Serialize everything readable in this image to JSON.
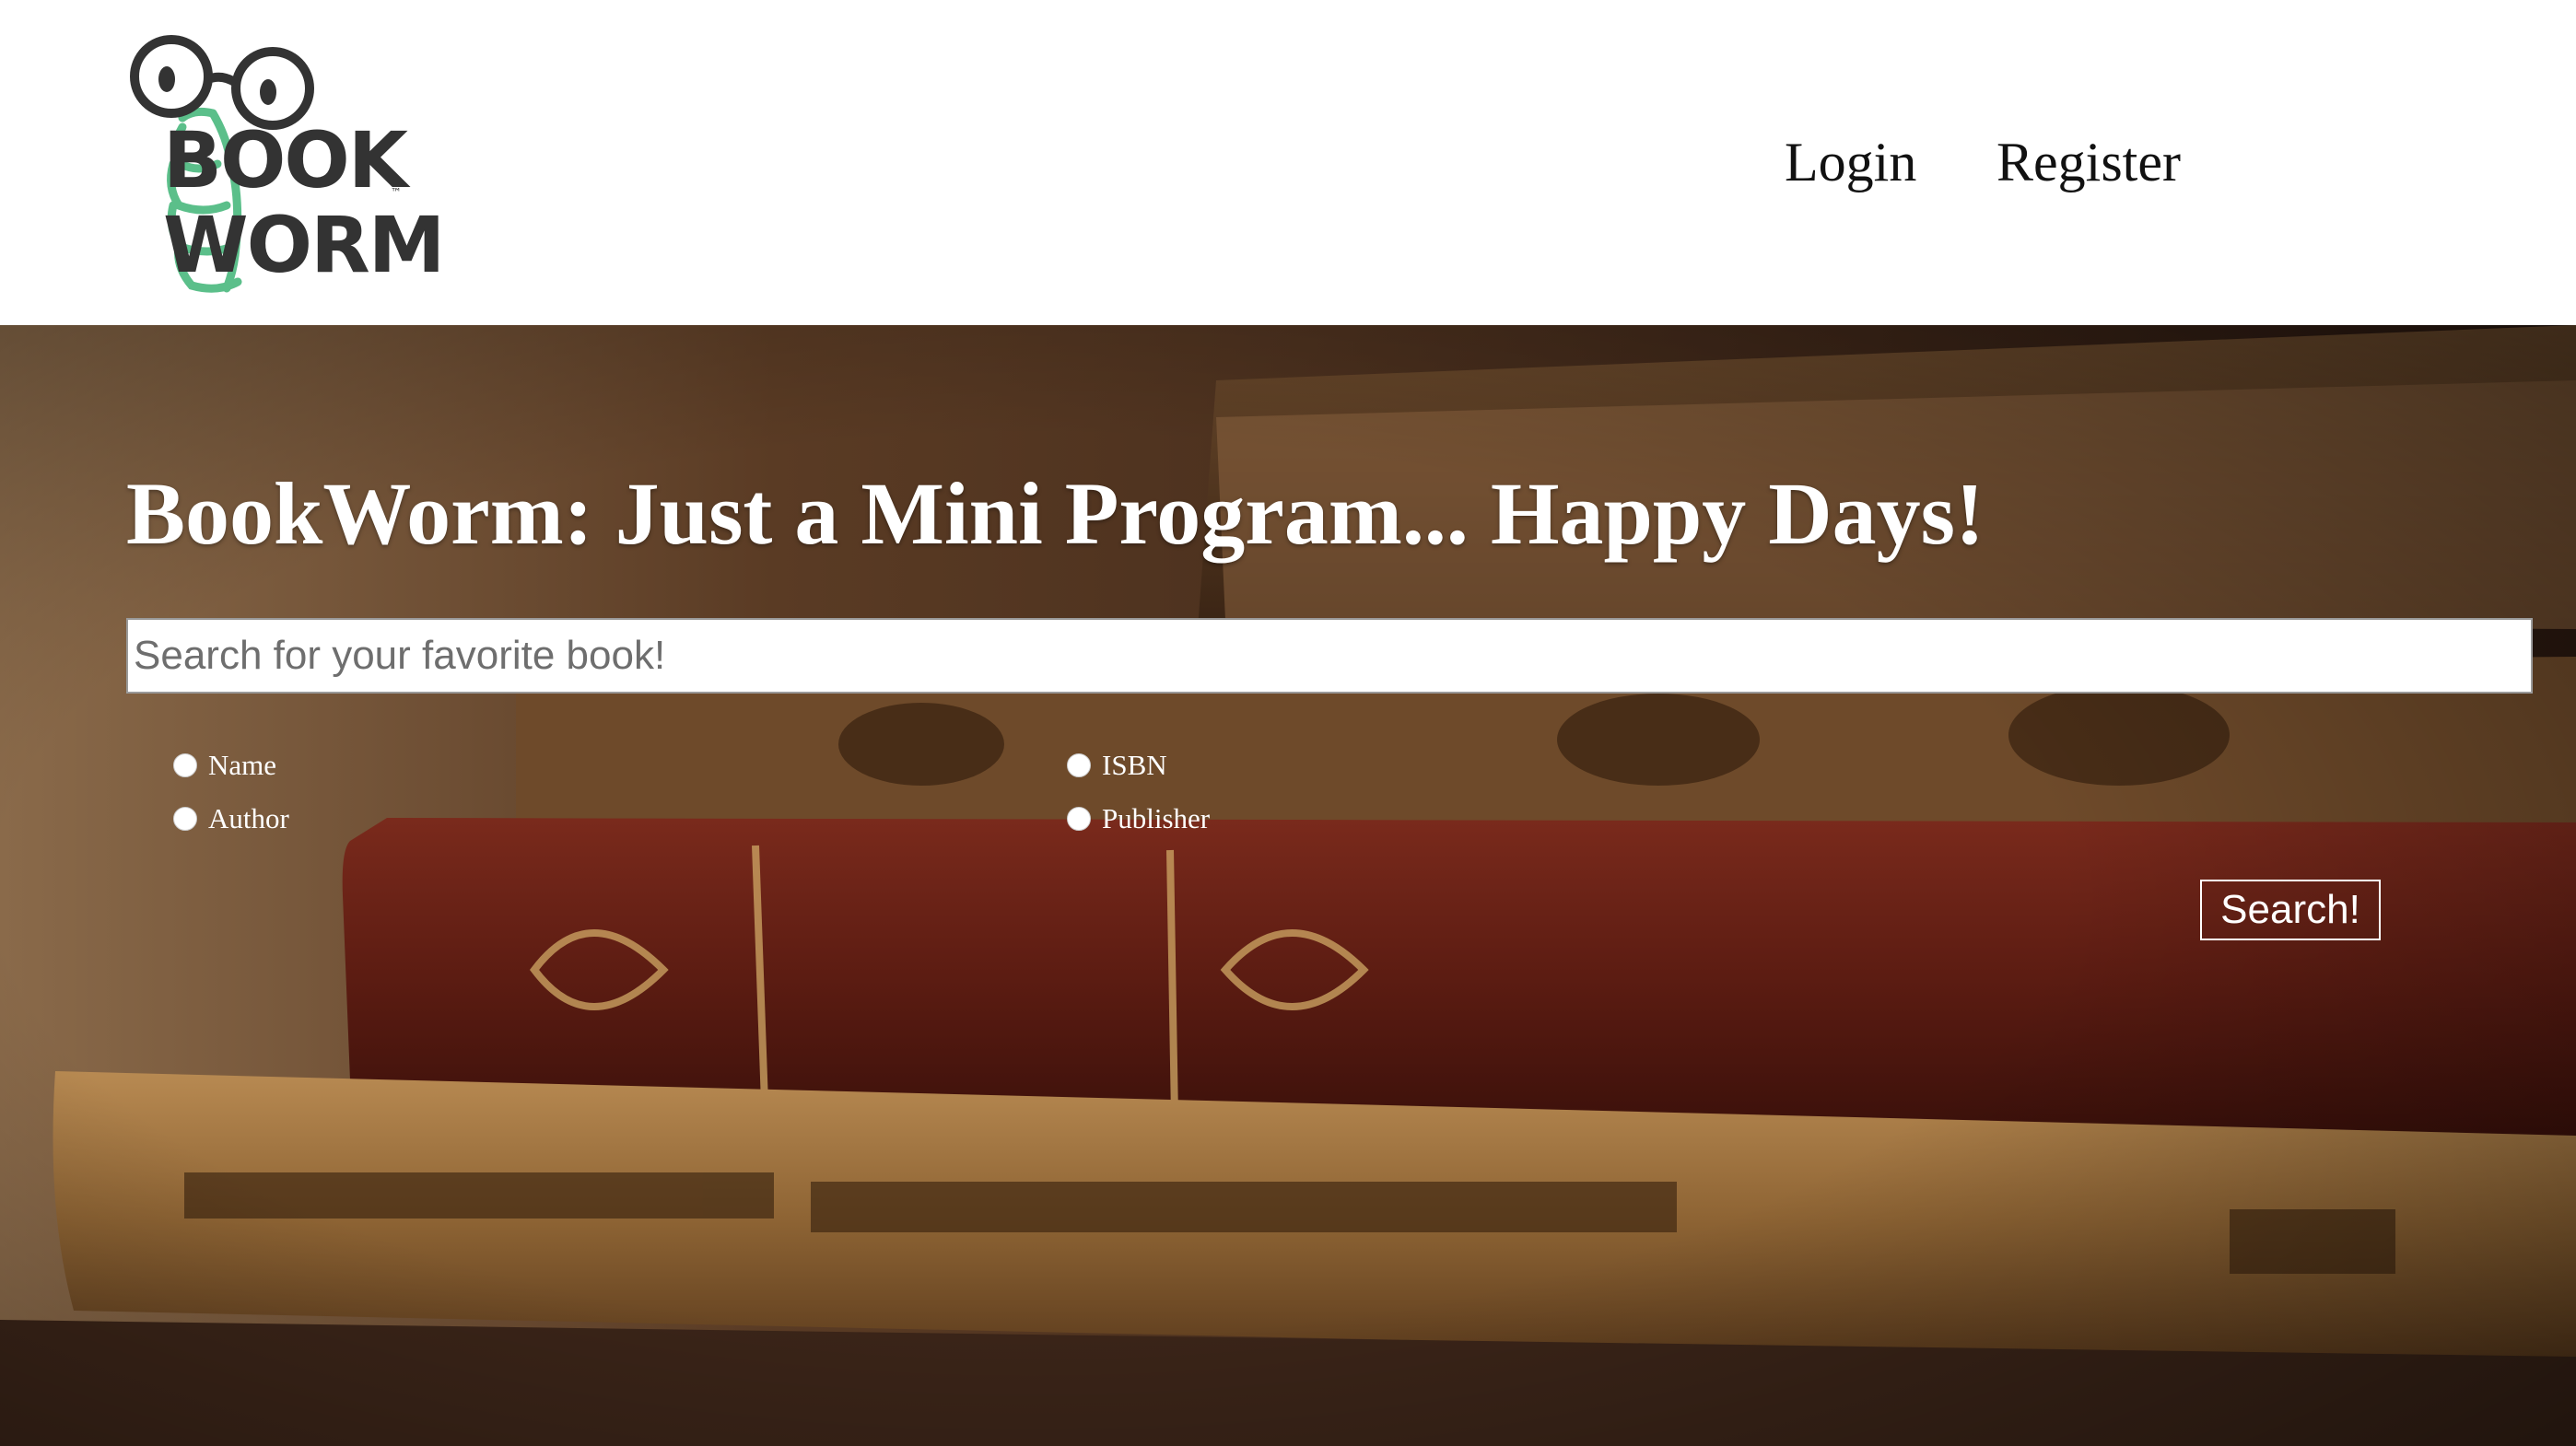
{
  "brand": {
    "logo_line1": "BOOK",
    "logo_line2": "WORM",
    "logo_tm": "™",
    "colors": {
      "worm_green": "#5BBF8A",
      "glasses": "#333333"
    }
  },
  "nav": {
    "login": "Login",
    "register": "Register"
  },
  "hero": {
    "title": "BookWorm: Just a Mini Program... Happy Days!",
    "search": {
      "placeholder": "Search for your favorite book!",
      "value": ""
    },
    "search_options": [
      {
        "label": "Name",
        "selected": false
      },
      {
        "label": "Author",
        "selected": false
      },
      {
        "label": "ISBN",
        "selected": false
      },
      {
        "label": "Publisher",
        "selected": false
      }
    ],
    "search_button": "Search!"
  }
}
